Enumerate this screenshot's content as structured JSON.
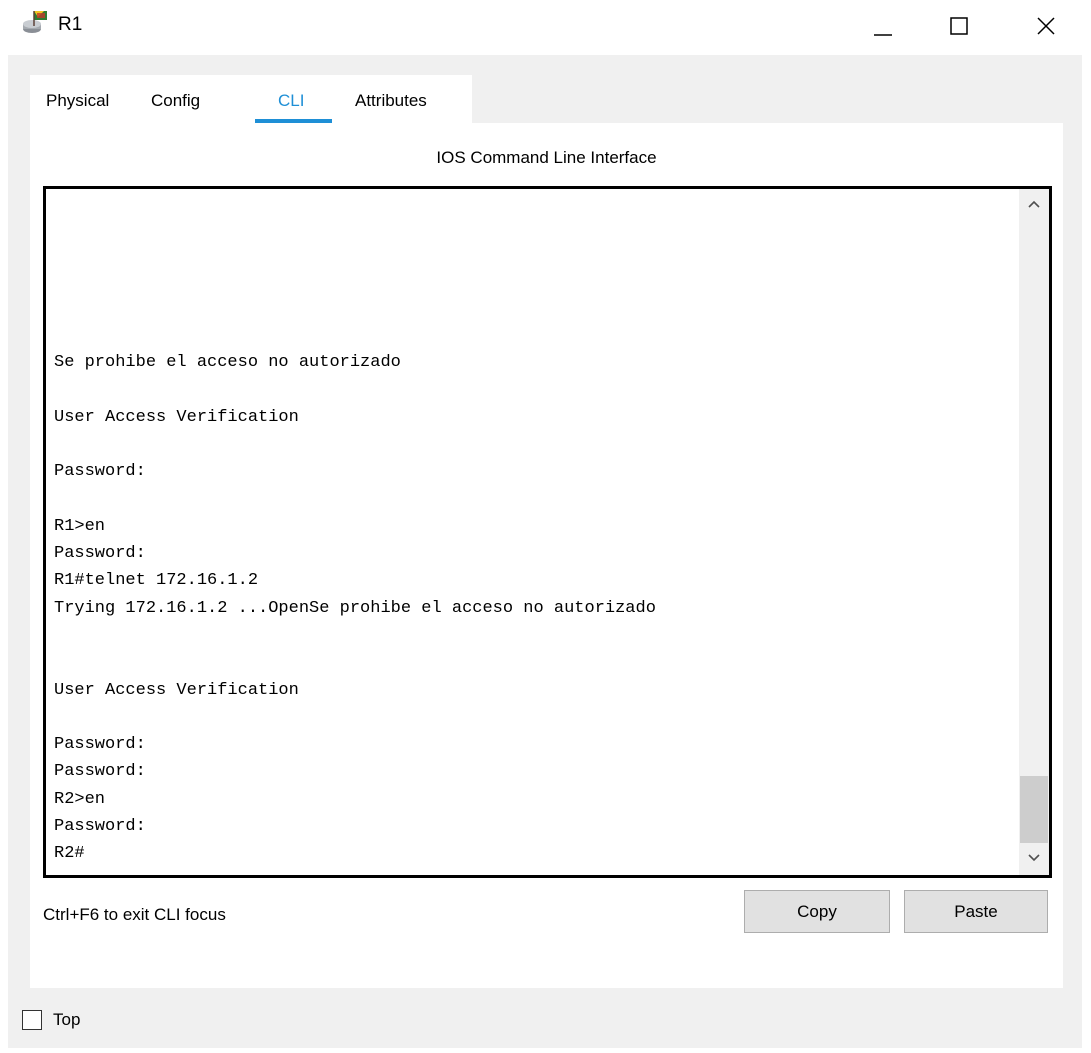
{
  "window": {
    "title": "R1",
    "app_icon": "router-icon",
    "controls": [
      "minimize-icon",
      "maximize-icon",
      "close-icon"
    ]
  },
  "tabs": [
    {
      "label": "Physical",
      "active": false
    },
    {
      "label": "Config",
      "active": false
    },
    {
      "label": "CLI",
      "active": true
    },
    {
      "label": "Attributes",
      "active": false
    }
  ],
  "panel": {
    "title": "IOS Command Line Interface"
  },
  "terminal": {
    "lines": [
      "Se prohibe el acceso no autorizado",
      "",
      "User Access Verification",
      "",
      "Password:",
      "",
      "R1>en",
      "Password:",
      "R1#telnet 172.16.1.2",
      "Trying 172.16.1.2 ...OpenSe prohibe el acceso no autorizado",
      "",
      "",
      "User Access Verification",
      "",
      "Password:",
      "Password:",
      "R2>en",
      "Password:",
      "R2#"
    ],
    "scrollbar": {
      "up_icon": "chevron-up-icon",
      "down_icon": "chevron-down-icon"
    }
  },
  "footer": {
    "focus_hint": "Ctrl+F6 to exit CLI focus",
    "copy_label": "Copy",
    "paste_label": "Paste"
  },
  "bottom": {
    "top_label": "Top",
    "top_checked": false
  },
  "colors": {
    "accent": "#1e8fd6",
    "frame_bg": "#f0f0f0",
    "button_bg": "#e1e1e1"
  }
}
